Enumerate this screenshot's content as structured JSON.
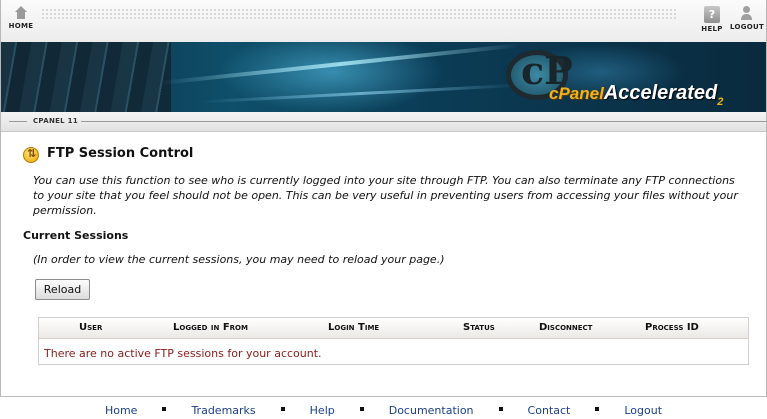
{
  "topnav": {
    "home_label": "HOME",
    "help_label": "HELP",
    "logout_label": "LOGOUT"
  },
  "banner": {
    "logo_cp": "cP",
    "logo_brand": "cPanel",
    "logo_product": "Accelerated",
    "logo_version": "2"
  },
  "breadcrumb": "CPANEL 11",
  "page": {
    "title": "FTP Session Control",
    "intro": "You can use this function to see who is currently logged into your site through FTP. You can also terminate any FTP connections to your site that you feel should not be open. This can be very useful in preventing users from accessing your files without your permission.",
    "section_title": "Current Sessions",
    "note": "(In order to view the current sessions, you may need to reload your page.)",
    "reload_label": "Reload"
  },
  "table": {
    "columns": [
      "User",
      "Logged in From",
      "Login Time",
      "Status",
      "Disconnect",
      "Process ID"
    ],
    "empty_message": "There are no active FTP sessions for your account."
  },
  "footer": {
    "links": [
      "Home",
      "Trademarks",
      "Help",
      "Documentation",
      "Contact",
      "Logout"
    ]
  },
  "colors": {
    "link": "#1b3f8a",
    "empty_message": "#8b1a1a",
    "banner_dark": "#0b2a3c",
    "logo_gold": "#f2b21d"
  }
}
